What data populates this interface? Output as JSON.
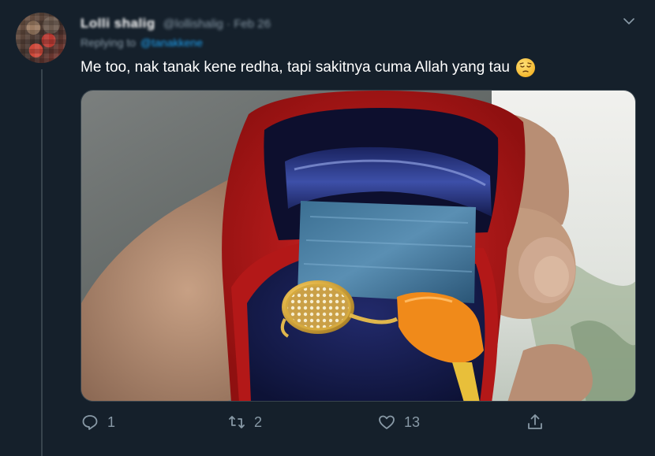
{
  "tweet": {
    "display_name": "Lolli shalig",
    "handle_meta": "@lollishalig · Feb 26",
    "reply_prefix": "Replying to",
    "reply_mention": "@tanakkene",
    "text": "Me too, nak tanak kene redha, tapi sakitnya cuma Allah yang tau",
    "emoji": "pensive-face-emoji",
    "media_subject": "gold-ring-in-red-box-photo"
  },
  "actions": {
    "reply_count": "1",
    "retweet_count": "2",
    "like_count": "13"
  },
  "icons": [
    "chevron-down-icon",
    "reply-icon",
    "retweet-icon",
    "like-icon",
    "share-icon"
  ],
  "colors": {
    "background": "#15202b",
    "text_primary": "#ffffff",
    "text_secondary": "#8899a6",
    "accent": "#1da1f2",
    "divider": "#38444d"
  }
}
